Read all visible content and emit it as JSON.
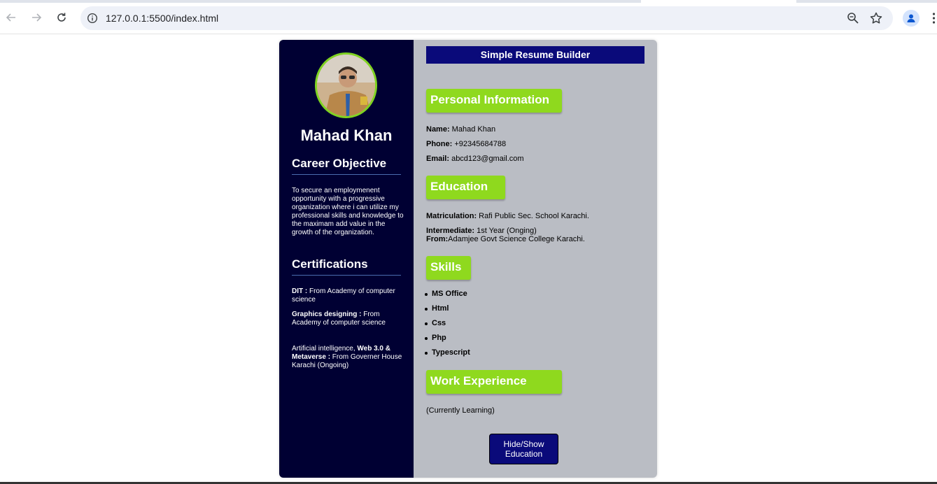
{
  "browser": {
    "url": "127.0.0.1:5500/index.html"
  },
  "resume": {
    "name": "Mahad Khan",
    "career_heading": "Career Objective",
    "career_text": "To secure an employmenent opportunity with a progressive organization where i can utilize my professional skills and knowledge to the maximam add value in the growth of the organization.",
    "cert_heading": "Certifications",
    "certs": [
      {
        "bold": "DIT :",
        "text": " From Academy of computer science"
      },
      {
        "bold": "Graphics designing :",
        "text": " From Academy of computer science"
      },
      {
        "pre": "Artificial intelligence, ",
        "bold": "Web 3.0 & Metaverse :",
        "text": " From Governer House Karachi (Ongoing)"
      }
    ],
    "app_title": "Simple Resume Builder",
    "personal_heading": "Personal Information",
    "personal": [
      {
        "label": "Name:",
        "value": " Mahad Khan"
      },
      {
        "label": "Phone:",
        "value": " +92345684788"
      },
      {
        "label": "Email:",
        "value": " abcd123@gmail.com"
      }
    ],
    "education_heading": "Education",
    "education": {
      "matric_label": "Matriculation:",
      "matric_value": " Rafi Public Sec. School Karachi.",
      "inter_label": "Intermediate:",
      "inter_value": " 1st Year (Onging)",
      "from_label": "From:",
      "from_value": "Adamjee Govt Science College Karachi."
    },
    "skills_heading": "Skills",
    "skills": [
      "MS Office",
      "Html",
      "Css",
      "Php",
      "Typescript"
    ],
    "work_heading": "Work Experience",
    "work_text": "(Currently Learning)",
    "toggle_label": "Hide/Show Education"
  },
  "colors": {
    "sidebar": "#000033",
    "main": "#babdc4",
    "accent_green": "#8fd91e",
    "title_blue": "#0a0a7a"
  }
}
